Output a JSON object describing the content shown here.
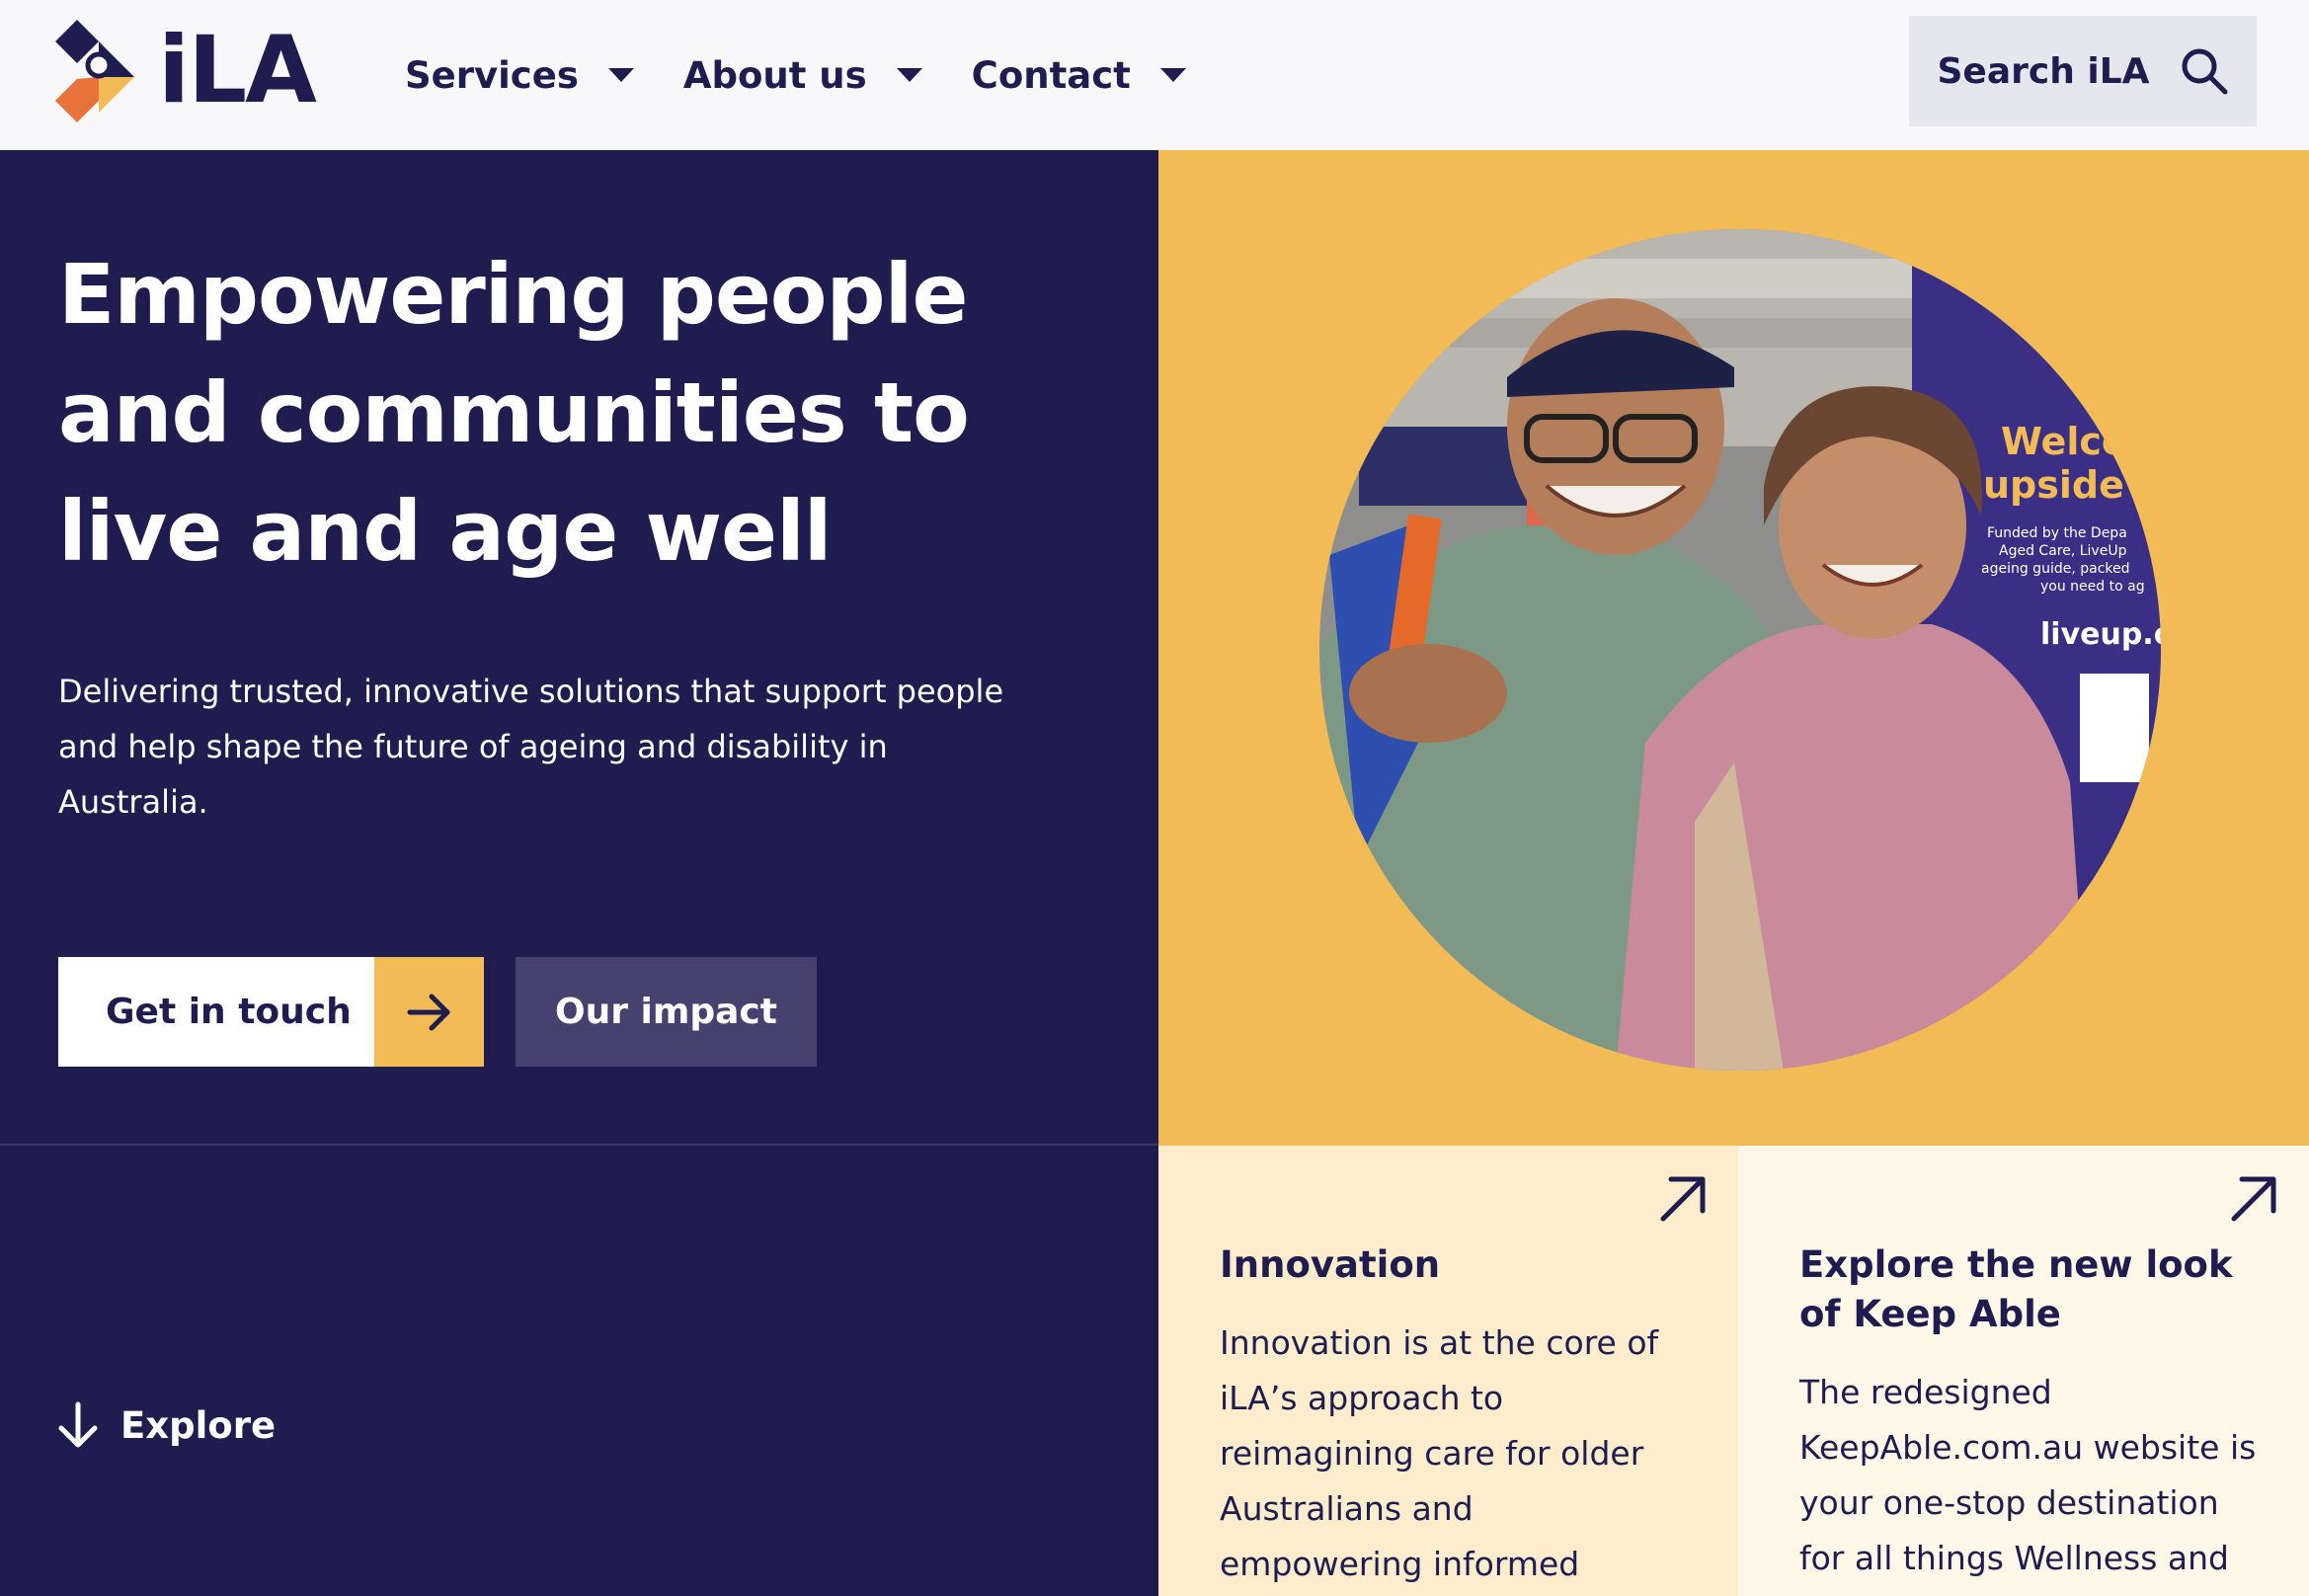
{
  "brand": {
    "name": "iLA"
  },
  "nav": {
    "items": [
      {
        "label": "Services"
      },
      {
        "label": "About us"
      },
      {
        "label": "Contact"
      }
    ],
    "search_label": "Search iLA"
  },
  "hero": {
    "title": "Empowering people and communities to live and age well",
    "subtitle": "Delivering trusted, innovative solutions that support people and help shape the future of ageing and disability in Australia.",
    "primary_button": "Get in touch",
    "secondary_button": "Our impact",
    "image_banner": {
      "line1": "Welco",
      "line2": "upside",
      "small": [
        "Funded by the Depa",
        "Aged Care, LiveUp",
        "ageing guide, packed",
        "you need to ag"
      ],
      "url": "liveup.c"
    }
  },
  "explore_label": "Explore",
  "cards": [
    {
      "title": "Innovation",
      "body": "Innovation is at the core of iLA’s approach to reimagining care for older Australians and empowering informed"
    },
    {
      "title": "Explore the new look of Keep Able",
      "body": "The redesigned KeepAble.com.au website is your one-stop destination for all things Wellness and"
    }
  ],
  "colors": {
    "navy": "#1f1c4f",
    "gold": "#f2bb55",
    "orange": "#e8733a",
    "card_light": "#fdedcd",
    "card_lighter": "#fff7e7"
  },
  "icons": {
    "search": "search-icon",
    "caret": "chevron-down-icon",
    "arrow_right": "arrow-right-icon",
    "arrow_down": "arrow-down-icon",
    "external": "arrow-up-right-icon"
  }
}
